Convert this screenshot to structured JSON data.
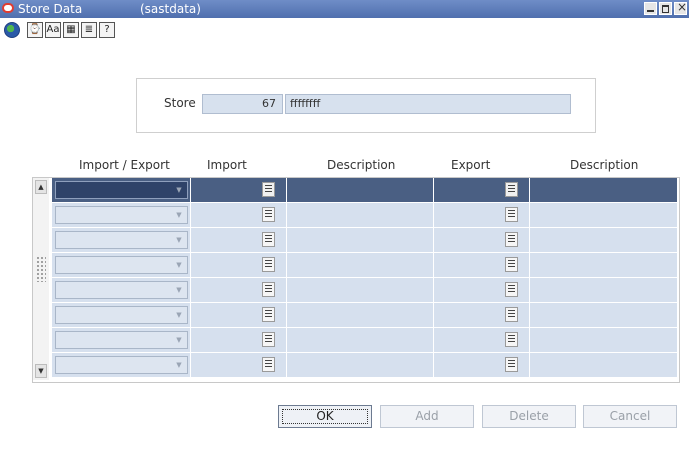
{
  "window": {
    "title": "Store Data",
    "subtitle": "(sastdata)"
  },
  "toolbar": {
    "icons": [
      "globe-icon",
      "help-icon",
      "spellcheck-icon",
      "calendar-icon",
      "notes-icon",
      "query-icon"
    ],
    "glyphs": [
      "⌚",
      "Aa",
      "▦",
      "≣",
      "?"
    ]
  },
  "store": {
    "label": "Store",
    "number": "67",
    "name": "ffffffff"
  },
  "table": {
    "headers": [
      "Import / Export",
      "Import",
      "Description",
      "Export",
      "Description"
    ],
    "row_count": 8,
    "selected_row": 0
  },
  "buttons": {
    "ok": "OK",
    "add": "Add",
    "delete": "Delete",
    "cancel": "Cancel"
  },
  "colors": {
    "titlebar": "#4f6fae",
    "cell": "#d6e0ee",
    "selected_row": "#4a5f83"
  }
}
